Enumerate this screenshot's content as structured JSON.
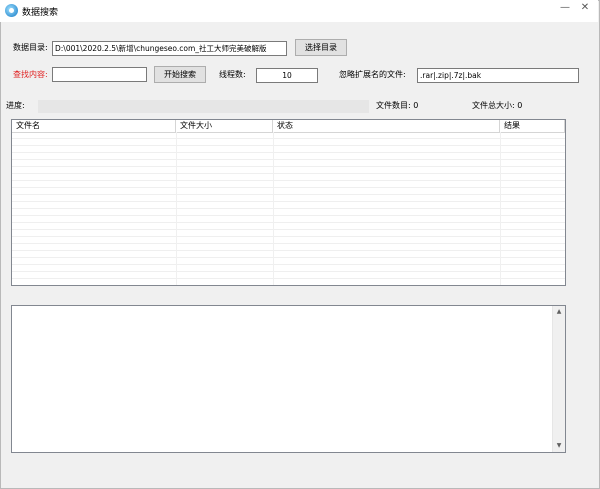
{
  "window": {
    "title": "数据搜索",
    "minimize": "—",
    "close": "✕"
  },
  "labels": {
    "data_dir": "数据目录:",
    "search_content": "查找内容:",
    "threads": "线程数:",
    "ignore_ext": "忽略扩展名的文件:",
    "progress": "进度:",
    "file_count": "文件数目: 0",
    "file_total_size": "文件总大小: 0"
  },
  "inputs": {
    "data_dir_value": "D:\\001\\2020.2.5\\新增\\chungeseo.com_社工大师完美破解版",
    "search_value": "",
    "threads_value": "10",
    "ignore_ext_value": ".rar|.zip|.7z|.bak"
  },
  "buttons": {
    "select_dir": "选择目录",
    "start_search": "开始搜索"
  },
  "progress": {
    "fraction": 0
  },
  "table": {
    "columns": [
      "文件名",
      "文件大小",
      "状态",
      "结果"
    ],
    "rows": []
  },
  "scrollbar": {
    "up": "▲",
    "down": "▼"
  }
}
